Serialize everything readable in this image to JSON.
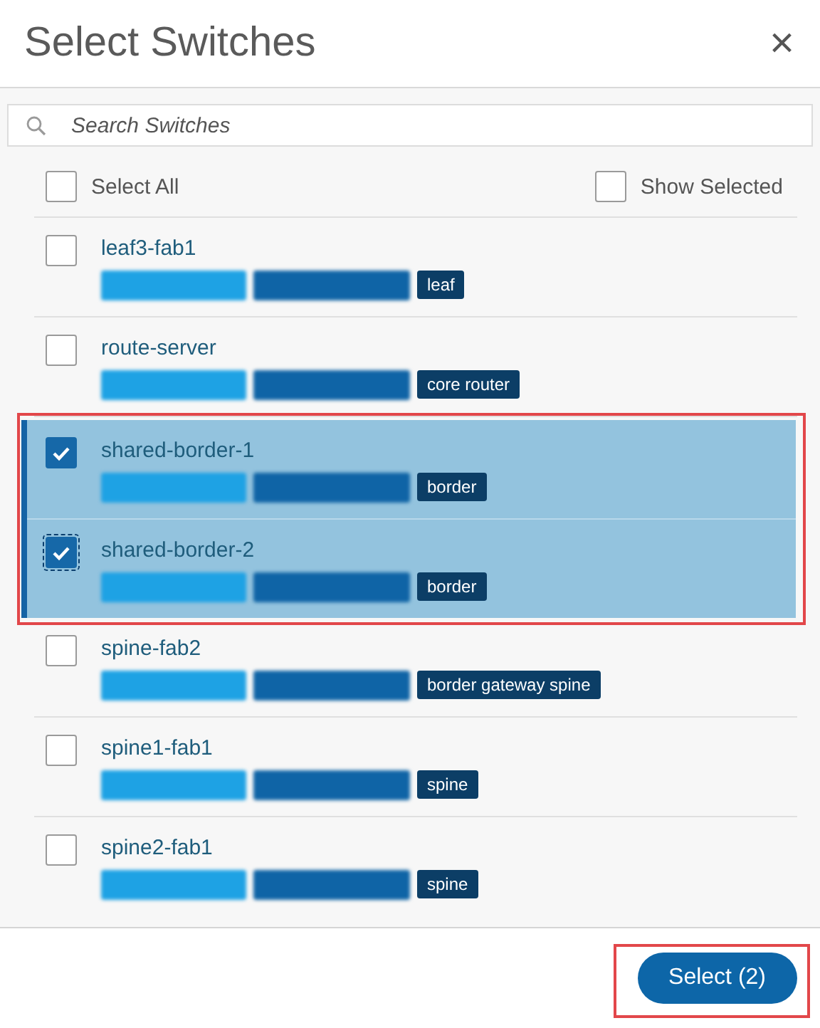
{
  "dialog": {
    "title": "Select Switches",
    "close": "×"
  },
  "search": {
    "placeholder": "Search Switches"
  },
  "select_all": {
    "label": "Select All",
    "checked": false
  },
  "show_selected": {
    "label": "Show Selected",
    "checked": false
  },
  "switches": [
    {
      "name": "leaf3-fab1",
      "role": "leaf",
      "selected": false,
      "focused": false
    },
    {
      "name": "route-server",
      "role": "core router",
      "selected": false,
      "focused": false
    },
    {
      "name": "shared-border-1",
      "role": "border",
      "selected": true,
      "focused": false
    },
    {
      "name": "shared-border-2",
      "role": "border",
      "selected": true,
      "focused": true
    },
    {
      "name": "spine-fab2",
      "role": "border gateway spine",
      "selected": false,
      "focused": false
    },
    {
      "name": "spine1-fab1",
      "role": "spine",
      "selected": false,
      "focused": false
    },
    {
      "name": "spine2-fab1",
      "role": "spine",
      "selected": false,
      "focused": false
    }
  ],
  "footer": {
    "button": "Select (2)"
  }
}
